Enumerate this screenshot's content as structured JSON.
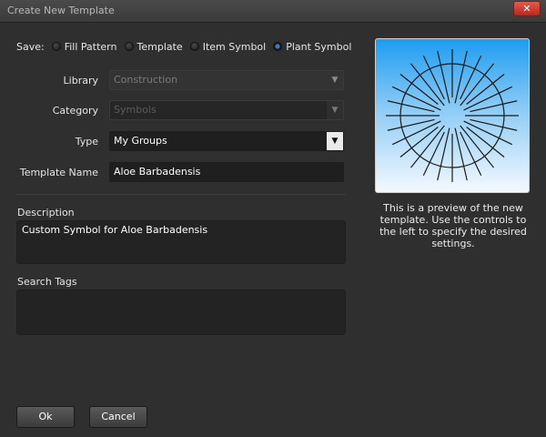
{
  "window": {
    "title": "Create New Template",
    "close_label": "✕"
  },
  "save": {
    "label": "Save:",
    "options": [
      {
        "label": "Fill Pattern",
        "selected": false
      },
      {
        "label": "Template",
        "selected": false
      },
      {
        "label": "Item Symbol",
        "selected": false
      },
      {
        "label": "Plant Symbol",
        "selected": true
      }
    ]
  },
  "form": {
    "library": {
      "label": "Library",
      "value": "Construction"
    },
    "category": {
      "label": "Category",
      "value": "Symbols"
    },
    "type": {
      "label": "Type",
      "value": "My Groups"
    },
    "template_name": {
      "label": "Template Name",
      "value": "Aloe Barbadensis"
    }
  },
  "description": {
    "label": "Description",
    "value": "Custom Symbol for Aloe Barbadensis"
  },
  "search_tags": {
    "label": "Search Tags",
    "value": ""
  },
  "preview": {
    "text": "This is a preview of the new template. Use the controls to the left to specify the desired settings."
  },
  "buttons": {
    "ok": "Ok",
    "cancel": "Cancel"
  },
  "colors": {
    "selected_radio": "#3d7ad1",
    "close_button": "#c9352a",
    "preview_top": "#1e9cf0"
  },
  "icons": {
    "preview_symbol": "radial-plant-symbol-icon",
    "dropdown": "chevron-down-icon"
  }
}
